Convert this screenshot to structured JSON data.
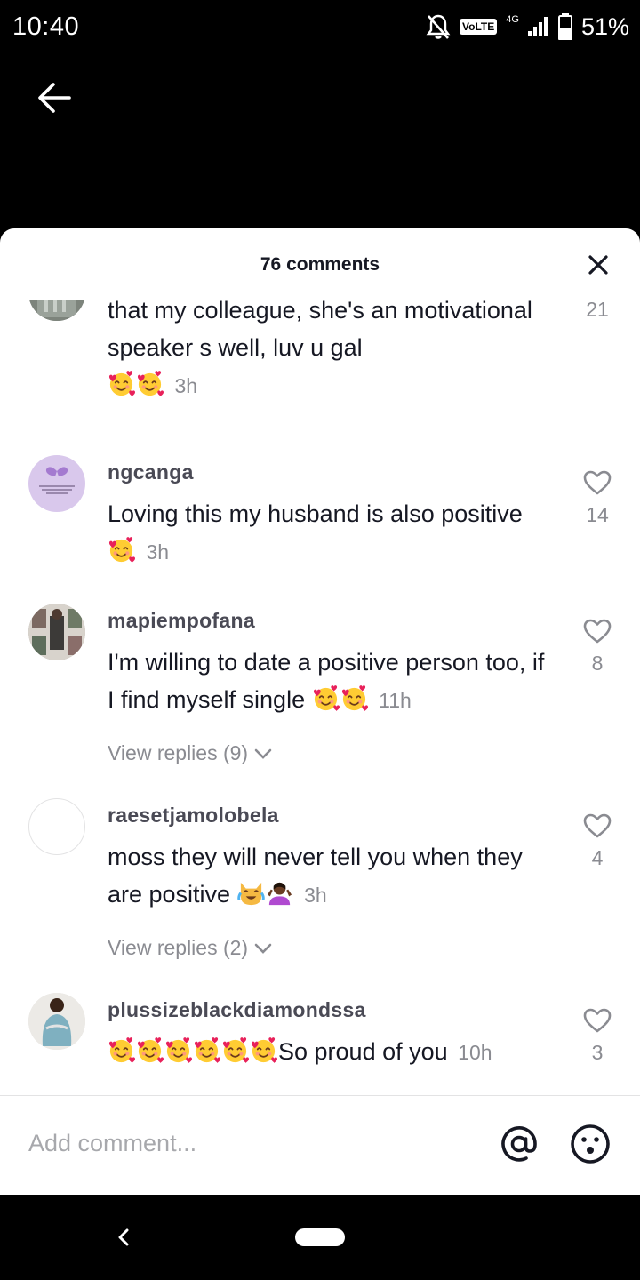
{
  "status_bar": {
    "time": "10:40",
    "volte": "VoLTE",
    "network": "4G",
    "battery": "51%"
  },
  "sheet": {
    "title": "76 comments"
  },
  "comments": [
    {
      "username": "",
      "text": "that my colleague, she's an motivational speaker s well, luv u gal",
      "emojis": [
        "smiling-face-with-hearts",
        "smiling-face-with-hearts"
      ],
      "time": "3h",
      "likes": "21"
    },
    {
      "username": "ngcanga",
      "text": "Loving this my husband is also positive",
      "emojis": [
        "smiling-face-with-hearts"
      ],
      "time": "3h",
      "likes": "14"
    },
    {
      "username": "mapiempofana",
      "text": "I'm willing to date a positive person too, if I find myself single",
      "emojis": [
        "smiling-face-with-hearts",
        "smiling-face-with-hearts"
      ],
      "time": "11h",
      "likes": "8",
      "replies": "View replies (9)"
    },
    {
      "username": "raesetjamolobela",
      "text": "moss they will never tell you when they are positive",
      "emojis": [
        "cat-with-tears-of-joy",
        "person-shrugging"
      ],
      "time": "3h",
      "likes": "4",
      "replies": "View replies (2)"
    },
    {
      "username": "plussizeblackdiamondssa",
      "text": "So proud of you",
      "emojis": [
        "smiling-face-with-hearts",
        "smiling-face-with-hearts",
        "smiling-face-with-hearts",
        "smiling-face-with-hearts",
        "smiling-face-with-hearts",
        "smiling-face-with-hearts"
      ],
      "time": "10h",
      "likes": "3"
    }
  ],
  "add_comment": {
    "placeholder": "Add comment..."
  },
  "icons": {
    "back": "back-arrow-icon",
    "close": "close-icon",
    "like": "heart-outline-icon",
    "mention": "at-sign-icon",
    "emoji": "emoji-face-icon"
  },
  "colors": {
    "text_primary": "#161823",
    "text_secondary": "#8a8b91",
    "sheet_bg": "#ffffff",
    "chrome_bg": "#000000"
  }
}
